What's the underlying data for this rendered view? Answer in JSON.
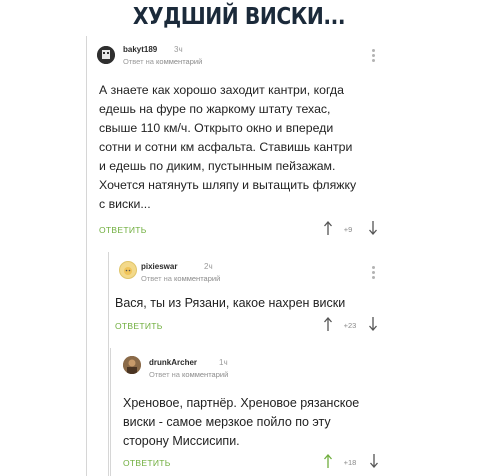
{
  "meme_title": "ХУДШИЙ ВИСКИ...",
  "comments": [
    {
      "username": "bakyt189",
      "time": "3ч",
      "reply_prefix": "Ответ на",
      "reply_target": "комментарий",
      "lines": [
        "А знаете как хорошо заходит кантри, когда",
        "едешь на фуре по жаркому штату техас,",
        "свыше 110 км/ч. Открыто окно и впереди",
        "сотни и сотни км асфальта. Ставишь кантри",
        "и едешь по диким, пустынным пейзажам.",
        "Хочется натянуть шляпу и вытащить фляжку",
        "с виски..."
      ],
      "reply_label": "ОТВЕТИТЬ",
      "rating": "+9"
    },
    {
      "username": "pixieswar",
      "time": "2ч",
      "reply_prefix": "Ответ на",
      "reply_target": "комментарий",
      "lines": [
        "Вася, ты из Рязани, какое нахрен виски"
      ],
      "reply_label": "ОТВЕТИТЬ",
      "rating": "+23"
    },
    {
      "username": "drunkArcher",
      "time": "1ч",
      "reply_prefix": "Ответ на",
      "reply_target": "комментарий",
      "lines": [
        "Хреновое, партнёр. Хреновое рязанское",
        "виски - самое мерзкое пойло по эту",
        "сторону Миссисипи."
      ],
      "reply_label": "ОТВЕТИТЬ",
      "rating": "+18"
    }
  ]
}
